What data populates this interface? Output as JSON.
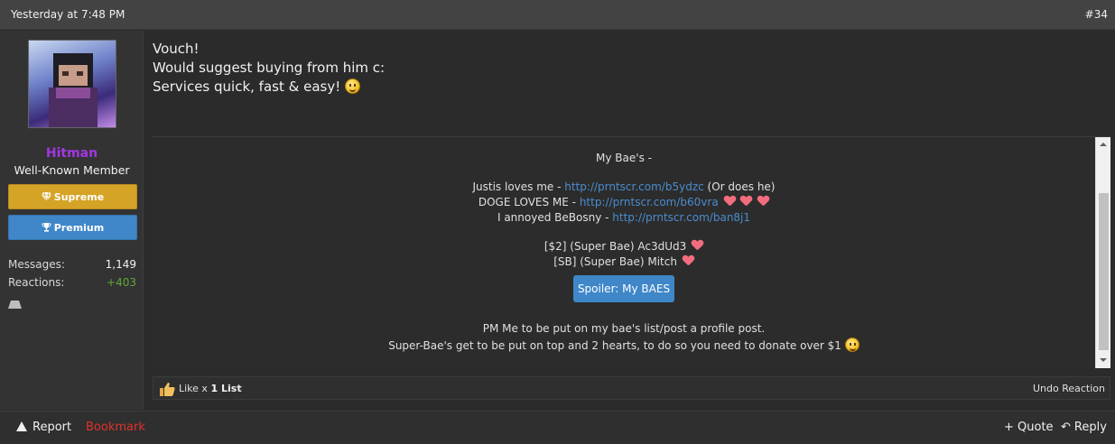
{
  "header": {
    "date": "Yesterday at 7:48 PM",
    "post_number": "#34"
  },
  "user": {
    "name": "Hitman",
    "title": "Well-Known Member",
    "name_color": "#a236e3",
    "banners": [
      {
        "label": "Supreme",
        "icon": "diamond-icon",
        "color": "#d5a326"
      },
      {
        "label": "Premium",
        "icon": "trophy-icon",
        "color": "#3f87c9"
      }
    ],
    "stats": {
      "messages_label": "Messages:",
      "messages_value": "1,149",
      "reactions_label": "Reactions:",
      "reactions_value": "+403"
    }
  },
  "message": {
    "lines": [
      "Vouch!",
      "Would suggest buying from him c:",
      "Services quick, fast & easy!"
    ]
  },
  "signature": {
    "title": "My Bae's -",
    "line1_text": "Justis loves me - ",
    "line1_link": "http://prntscr.com/b5ydzc",
    "line1_suffix": " (Or does he)",
    "line2_text": "DOGE LOVES ME - ",
    "line2_link": "http://prntscr.com/b60vra",
    "line3_text": "I annoyed BeBosny - ",
    "line3_link": "http://prntscr.com/ban8j1",
    "bae1": "[$2] (Super Bae) Ac3dUd3",
    "bae2": "[SB] (Super Bae) Mitch",
    "spoiler_label": "Spoiler: My BAES",
    "pm_line": "PM Me to be put on my bae's list/post a profile post.",
    "donate_line": "Super-Bae's get to be put on top and 2 hearts, to do so you need to donate over $1"
  },
  "reactions": {
    "like_label": "Like x",
    "like_count": "1",
    "list_label": "List",
    "undo_label": "Undo Reaction"
  },
  "footer": {
    "report_label": "Report",
    "bookmark_label": "Bookmark",
    "quote_label": "+ Quote",
    "reply_label": "Reply"
  },
  "colors": {
    "accent_blue": "#3f87c9",
    "link": "#4a8ccf",
    "gold": "#d5a326",
    "positive": "#63a53b",
    "bookmark_red": "#e0322b"
  }
}
